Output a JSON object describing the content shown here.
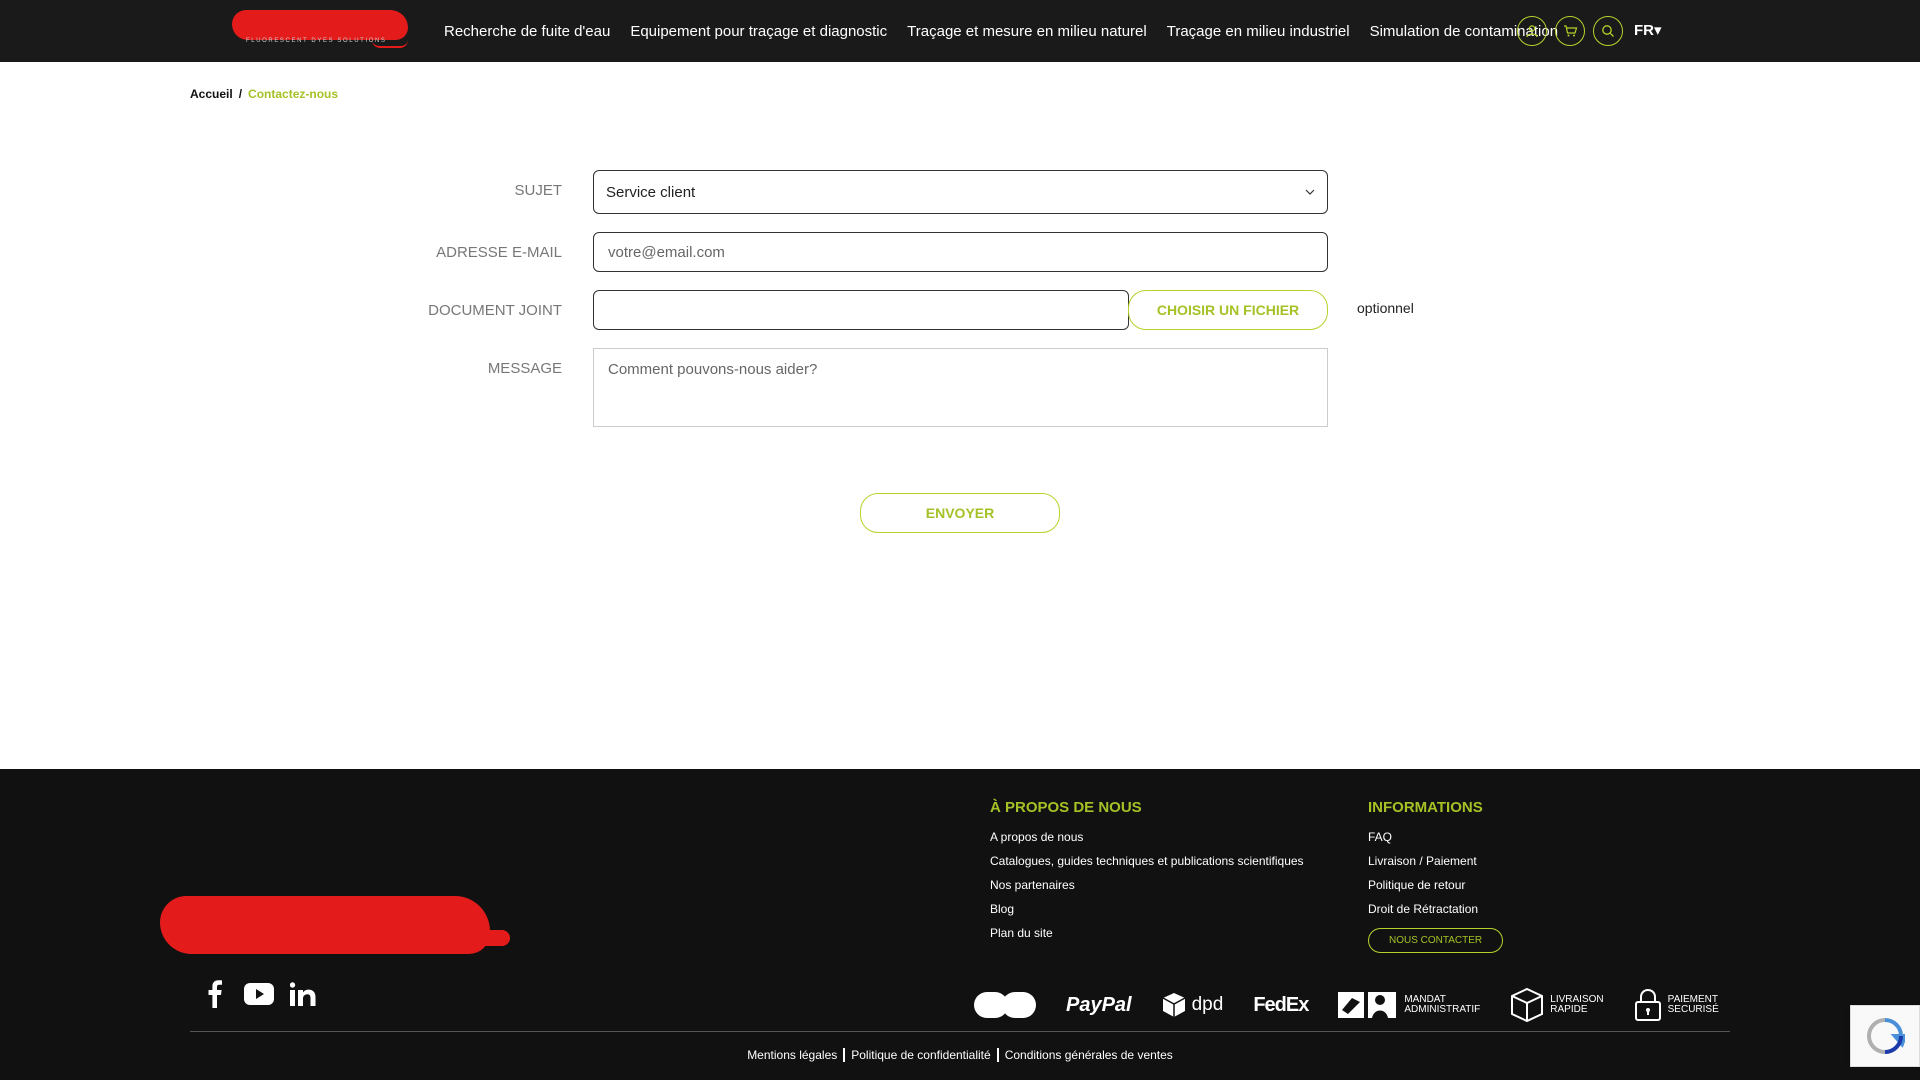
{
  "header": {
    "logo_tagline": "FLUORESCENT DYES SOLUTIONS",
    "nav": [
      {
        "label": "Recherche de fuite d'eau"
      },
      {
        "label": "Equipement pour traçage et diagnostic"
      },
      {
        "label": "Traçage et mesure en milieu naturel"
      },
      {
        "label": "Traçage en milieu industriel"
      },
      {
        "label": "Simulation de contamination"
      }
    ],
    "icons": [
      "user-icon",
      "cart-icon",
      "search-icon"
    ],
    "language": "FR▾"
  },
  "breadcrumb": {
    "home": "Accueil",
    "separator": "/",
    "current": "Contactez-nous"
  },
  "form": {
    "subject_label": "SUJET",
    "subject_value": "Service client",
    "email_label": "ADRESSE E-MAIL",
    "email_placeholder": "votre@email.com",
    "attachment_label": "DOCUMENT JOINT",
    "attachment_button": "CHOISIR UN FICHIER",
    "attachment_note": "optionnel",
    "message_label": "MESSAGE",
    "message_placeholder": "Comment pouvons-nous aider?",
    "submit_label": "ENVOYER"
  },
  "footer": {
    "about": {
      "heading": "À PROPOS DE NOUS",
      "links": [
        "A propos de nous",
        "Catalogues, guides techniques et publications scientifiques",
        "Nos partenaires",
        "Blog",
        "Plan du site"
      ]
    },
    "info": {
      "heading": "INFORMATIONS",
      "links": [
        "FAQ",
        "Livraison / Paiement",
        "Politique de retour",
        "Droit de Rétractation"
      ],
      "contact_button": "NOUS CONTACTER"
    },
    "payments": {
      "paypal": "PayPal",
      "dpd": "dpd",
      "fedex": "FedEx",
      "mandat_1": "MANDAT",
      "mandat_2": "ADMINISTRATIF",
      "livraison_1": "LIVRAISON",
      "livraison_2": "RAPIDE",
      "paiement_1": "PAIEMENT",
      "paiement_2": "SECURISÉ"
    },
    "legal": [
      "Mentions légales",
      "Politique de confidentialité",
      "Conditions générales de ventes"
    ]
  },
  "colors": {
    "accent": "#a4c226",
    "header_bg": "#1a1a1a",
    "footer_bg": "#111111",
    "redaction": "#e31b1b"
  }
}
